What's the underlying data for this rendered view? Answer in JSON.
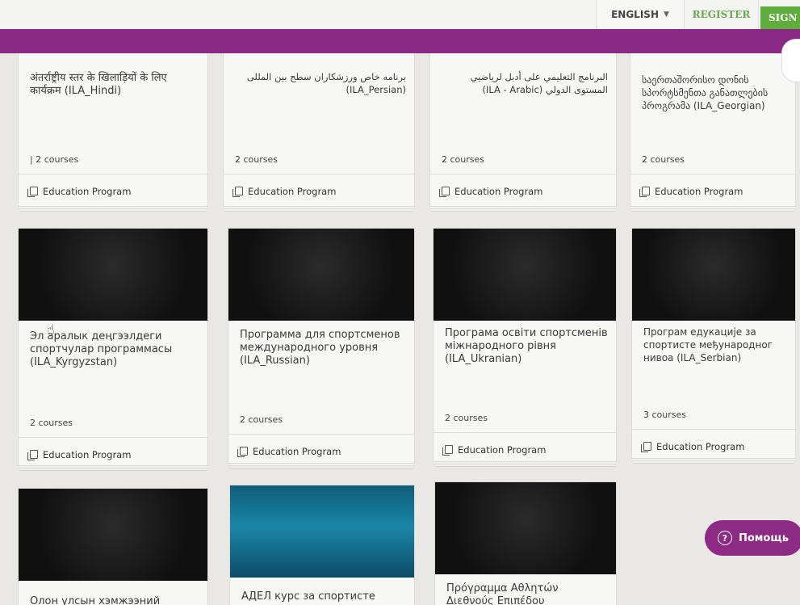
{
  "header": {
    "language": "ENGLISH",
    "register_label": "REGISTER",
    "sign_in_label": "SIGN"
  },
  "cards": [
    {
      "title": "अंतर्राष्ट्रीय स्तर के खिलाड़ियों के लिए कार्यक्रम (ILA_Hindi)",
      "count": "| 2 courses",
      "type": "Education Program"
    },
    {
      "title": "برنامه خاص ورزشکاران سطح بین المللی (ILA_Persian)",
      "count": "2 courses",
      "type": "Education Program"
    },
    {
      "title": "البرنامج التعليمي على أدبل لرياضيي المستوى الدولي (ILA - Arabic)",
      "count": "2 courses",
      "type": "Education Program"
    },
    {
      "title": "საერთაშორისო დონის სპორტსმენთა განათლების პროგრამა (ILA_Georgian)",
      "count": "2 courses",
      "type": "Education Program"
    },
    {
      "title": "Эл аралык деңгээлдеги спортчулар программасы (ILA_Kyrgyzstan)",
      "count": "2 courses",
      "type": "Education Program"
    },
    {
      "title": "Программа для спортсменов международного уровня (ILA_Russian)",
      "count": "2 courses",
      "type": "Education Program"
    },
    {
      "title": "Програма освіти спортсменів міжнародного рівня (ILA_Ukranian)",
      "count": "2 courses",
      "type": "Education Program"
    },
    {
      "title": "Програм едукације за спортисте међународног нивоа (ILA_Serbian)",
      "count": "3 courses",
      "type": "Education Program"
    },
    {
      "title": "Олон улсын хэмжээний"
    },
    {
      "title": "АДЕЛ курс за спортисте"
    },
    {
      "title": "Πρόγραμμα Αθλητών Διεθνούς Επιπέδου"
    }
  ],
  "help": {
    "label": "Помощь",
    "icon": "question-circle-icon"
  },
  "colors": {
    "brand_purple": "#8a2a86",
    "register_green": "#6aa84f",
    "sign_in_green": "#5fae3d"
  }
}
